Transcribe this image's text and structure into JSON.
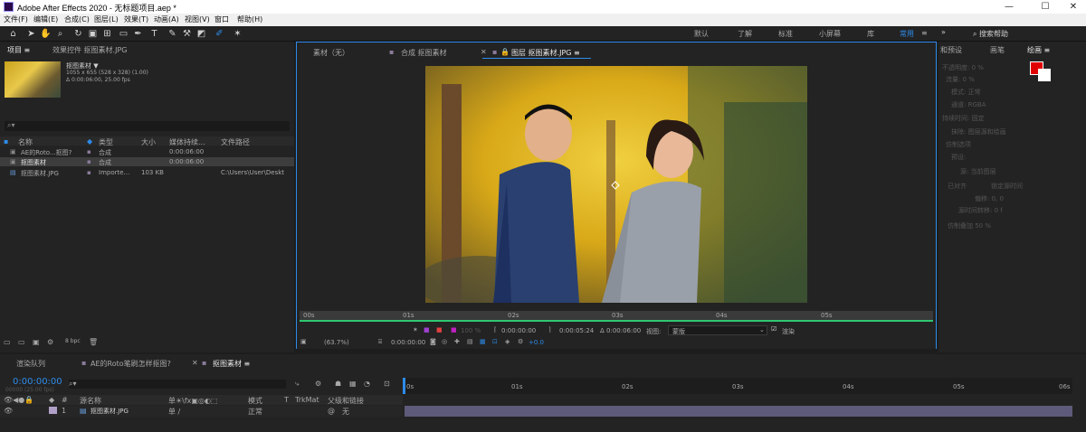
{
  "window": {
    "title": "Adobe After Effects 2020 - 无标题项目.aep *",
    "minimize": "—",
    "maximize": "☐",
    "close": "✕"
  },
  "menu": [
    "文件(F)",
    "编辑(E)",
    "合成(C)",
    "图层(L)",
    "效果(T)",
    "动画(A)",
    "视图(V)",
    "窗口",
    "帮助(H)"
  ],
  "workspaces": [
    "默认",
    "了解",
    "标准",
    "小屏幕",
    "库",
    "常用"
  ],
  "active_workspace": "常用",
  "search_help": "搜索帮助",
  "project_panel": {
    "tab": "项目 ≡",
    "effects_tab": "效果控件 抠图素材.JPG",
    "item_name": "抠图素材 ▼",
    "item_info1": "1055 x 655 (528 x 328) (1.00)",
    "item_info2": "Δ 0:00:06:00, 25.00 fps",
    "columns": [
      "名称",
      "类型",
      "大小",
      "媒体持续...",
      "文件路径"
    ],
    "rows": [
      {
        "name": "AE的Roto...抠图?",
        "type": "合成",
        "size": "",
        "duration": "0:00:06:00",
        "path": ""
      },
      {
        "name": "抠图素材",
        "type": "合成",
        "size": "",
        "duration": "0:00:06:00",
        "path": ""
      },
      {
        "name": "抠图素材.JPG",
        "type": "Importe...",
        "size": "103 KB",
        "duration": "",
        "path": "C:\\Users\\User\\Deskt"
      }
    ],
    "bpc": "8 bpc"
  },
  "comp_panel": {
    "tabs": [
      "素材（无）",
      "合成 抠图素材",
      "图层 抠图素材.JPG ≡"
    ],
    "ruler_ticks": [
      "00s",
      "01s",
      "02s",
      "03s",
      "04s",
      "05s"
    ],
    "zoom": "(63.7%)",
    "t1": "0:00:00:00",
    "t2": "0:00:05:24",
    "t3": "Δ 0:00:06:00",
    "view_label": "视图:",
    "view_value": "蒙版",
    "render_label": "渲染",
    "offset": "+0.0",
    "percent": "100 %"
  },
  "right_panel": {
    "tabs": [
      "和预设",
      "画笔",
      "绘画 ≡"
    ],
    "rows": [
      "不透明度: 0 %",
      "流量: 0 %",
      "模式: 正常",
      "通道: RGBA",
      "持续时间: 固定",
      "抹除: 图层源和绘画",
      "仿制选项",
      "预设:",
      "源: 当前图层",
      "已对齐",
      "锁定源时间",
      "偏移: 0, 0",
      "源时间转移: 0 f",
      "仿制叠加 50 %"
    ]
  },
  "timeline": {
    "tabs": [
      "渲染队列",
      "AE的Roto笔刷怎样抠图?",
      "抠图素材 ≡"
    ],
    "timecode": "0:00:00:00",
    "fps": "00000 (25.00 fps)",
    "cols": [
      "源名称",
      "模式",
      "T",
      "TrkMat",
      "父级和链接"
    ],
    "layer": {
      "index": "1",
      "name": "抠图素材.JPG",
      "mode": "正常",
      "parent": "无"
    },
    "ticks": [
      "0s",
      "01s",
      "02s",
      "03s",
      "04s",
      "05s",
      "06s"
    ]
  }
}
